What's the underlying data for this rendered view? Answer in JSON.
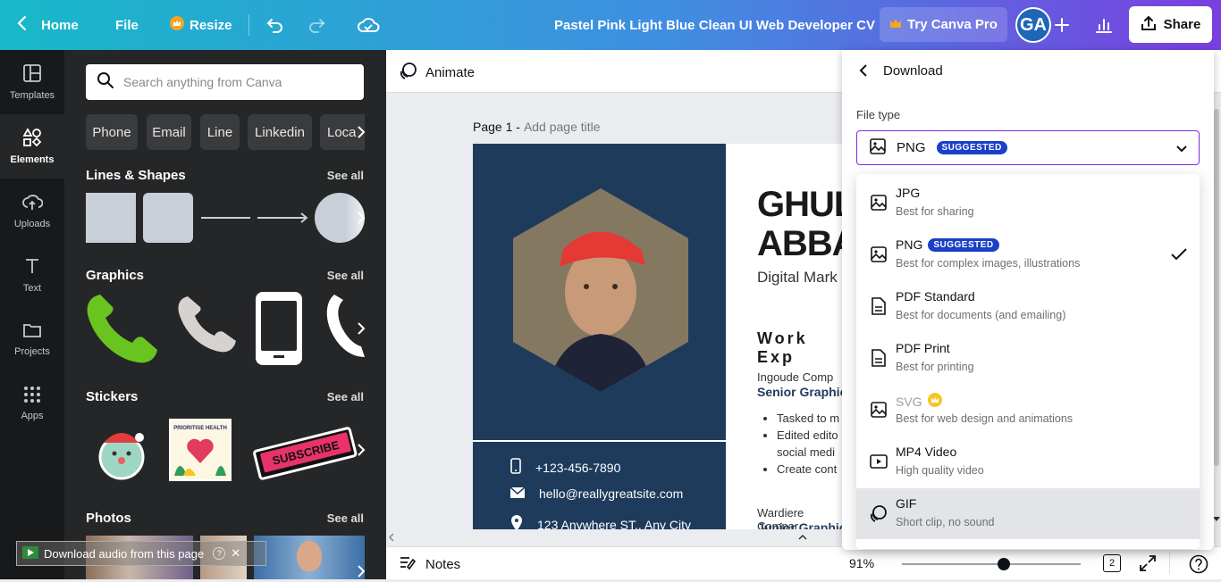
{
  "topbar": {
    "home": "Home",
    "file": "File",
    "resize": "Resize",
    "doc_title": "Pastel Pink Light Blue Clean UI Web Developer CV",
    "try_pro": "Try Canva Pro",
    "avatar_initials": "GA",
    "share": "Share"
  },
  "rail": {
    "items": [
      {
        "label": "Templates",
        "icon": "templates-icon"
      },
      {
        "label": "Elements",
        "icon": "elements-icon"
      },
      {
        "label": "Uploads",
        "icon": "upload-icon"
      },
      {
        "label": "Text",
        "icon": "text-icon"
      },
      {
        "label": "Projects",
        "icon": "folder-icon"
      },
      {
        "label": "Apps",
        "icon": "apps-icon"
      }
    ]
  },
  "panel": {
    "search_placeholder": "Search anything from Canva",
    "chips": [
      "Phone",
      "Email",
      "Line",
      "Linkedin",
      "Loca"
    ],
    "sections": {
      "lines_shapes": "Lines & Shapes",
      "graphics": "Graphics",
      "stickers": "Stickers",
      "photos": "Photos"
    },
    "see_all": "See all",
    "sticker_health_text": "PRIORITISE HEALTH",
    "sticker_subscribe_text": "SUBSCRIBE"
  },
  "editor": {
    "animate": "Animate",
    "page_label": "Page 1 -",
    "page_title_placeholder": "Add page title",
    "cv": {
      "name_line1": "GHUL",
      "name_line2": "ABBA",
      "role": "Digital Mark",
      "section": "Work Exp",
      "job1_company": "Ingoude Comp",
      "job1_title": "Senior Graphic",
      "bullets": [
        "Tasked to m",
        "Edited edito",
        "social medi",
        "Create cont"
      ],
      "job2_company": "Wardiere Compar",
      "job2_title": "Junior Graphic D",
      "phone": "+123-456-7890",
      "email": "hello@reallygreatsite.com",
      "address": "123 Anywhere ST., Any City"
    }
  },
  "bottombar": {
    "notes": "Notes",
    "zoom": "91%",
    "zoom_value": 91,
    "pages_count": "2"
  },
  "download": {
    "title": "Download",
    "file_type_label": "File type",
    "selected": "PNG",
    "suggested_badge": "SUGGESTED",
    "options": [
      {
        "name": "JPG",
        "desc": "Best for sharing",
        "icon": "image-icon"
      },
      {
        "name": "PNG",
        "desc": "Best for complex images, illustrations",
        "icon": "image-icon",
        "badge": "SUGGESTED",
        "checked": true
      },
      {
        "name": "PDF Standard",
        "desc": "Best for documents (and emailing)",
        "icon": "document-icon"
      },
      {
        "name": "PDF Print",
        "desc": "Best for printing",
        "icon": "document-icon"
      },
      {
        "name": "SVG",
        "desc": "Best for web design and animations",
        "icon": "image-icon",
        "pro": true
      },
      {
        "name": "MP4 Video",
        "desc": "High quality video",
        "icon": "video-icon"
      },
      {
        "name": "GIF",
        "desc": "Short clip, no sound",
        "icon": "gif-icon",
        "hover": true
      }
    ]
  },
  "toast": {
    "text": "Download audio from this page"
  },
  "colors": {
    "accent_purple": "#7d2ae8",
    "badge_blue": "#1a3fc9",
    "cv_navy": "#1f3b5c",
    "phone_green": "#6ac41f"
  }
}
